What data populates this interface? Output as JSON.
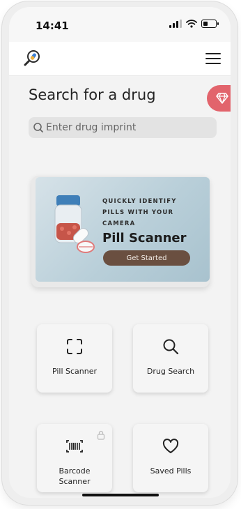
{
  "status_bar": {
    "time": "14:41"
  },
  "header": {
    "logo_icon": "magnifier-pill-icon",
    "menu_icon": "hamburger-icon"
  },
  "page": {
    "title": "Search for a drug",
    "premium_icon": "diamond-icon"
  },
  "search": {
    "placeholder": "Enter drug imprint",
    "icon": "search-icon"
  },
  "banner": {
    "subtitle": "QUICKLY IDENTIFY PILLS WITH YOUR CAMERA",
    "title": "Pill Scanner",
    "button_label": "Get Started"
  },
  "tiles": [
    {
      "label": "Pill Scanner",
      "icon": "scan-frame-icon",
      "locked": false
    },
    {
      "label": "Drug Search",
      "icon": "search-icon",
      "locked": false
    },
    {
      "label": "Barcode Scanner",
      "icon": "barcode-icon",
      "locked": true
    },
    {
      "label": "Saved Pills",
      "icon": "heart-icon",
      "locked": false
    }
  ],
  "colors": {
    "accent": "#e2646c",
    "button": "#6a4f40",
    "background": "#f3f3f3"
  }
}
